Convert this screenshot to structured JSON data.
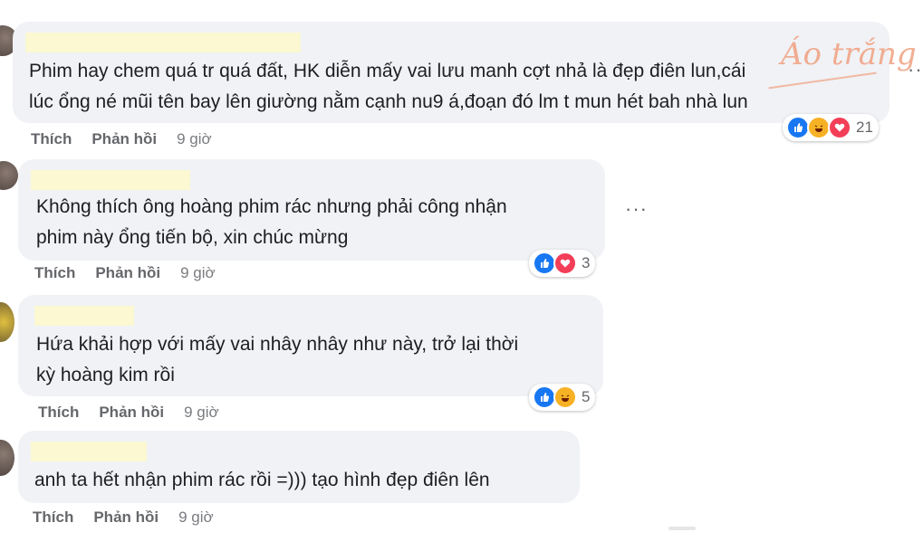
{
  "watermark": {
    "text": "Áo trắng"
  },
  "comments": [
    {
      "text_lines": [
        "Phim hay chem quá tr quá đất, HK diễn mấy vai lưu manh cợt nhả là đẹp điên lun,cái",
        "lúc ổng né mũi tên bay lên giường nằm cạnh nu9 á,đoạn đó lm t mun hét bah nhà lun"
      ],
      "actions": {
        "like": "Thích",
        "reply": "Phản hồi",
        "time": "9 giờ"
      },
      "reactions": [
        "like",
        "haha",
        "love"
      ],
      "reaction_count": "21",
      "more": "···"
    },
    {
      "text_lines": [
        "Không thích ông hoàng phim rác nhưng phải công nhận",
        "phim này ổng tiến bộ, xin chúc mừng"
      ],
      "actions": {
        "like": "Thích",
        "reply": "Phản hồi",
        "time": "9 giờ"
      },
      "reactions": [
        "like",
        "love"
      ],
      "reaction_count": "3",
      "more": "···"
    },
    {
      "text_lines": [
        "Hứa khải hợp với mấy vai nhây nhây như này, trở lại thời",
        "kỳ hoàng kim rồi"
      ],
      "actions": {
        "like": "Thích",
        "reply": "Phản hồi",
        "time": "9 giờ"
      },
      "reactions": [
        "like",
        "haha"
      ],
      "reaction_count": "5"
    },
    {
      "text_lines": [
        "anh ta hết nhận phim rác rồi =))) tạo hình đẹp điên lên"
      ],
      "actions": {
        "like": "Thích",
        "reply": "Phản hồi",
        "time": "9 giờ"
      }
    }
  ],
  "colors": {
    "bubble": "#f0f2f5",
    "like": "#1877f2",
    "haha": "#f7b125",
    "love": "#f33e58",
    "watermark": "#f0a080"
  }
}
